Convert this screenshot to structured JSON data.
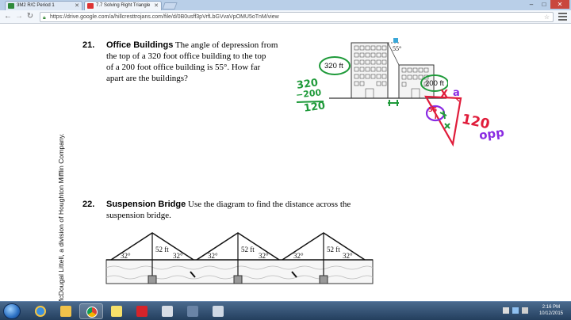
{
  "browser": {
    "tabs": [
      {
        "label": "3M2 R/C Period 1",
        "active": false
      },
      {
        "label": "7.7 Solving Right Triangle",
        "active": true
      }
    ],
    "url": "https://drive.google.com/a/hillcresttrojans.com/file/d/0B0usff3pVrfLbGVvaVpOMU5oTnM/view"
  },
  "page": {
    "copyright": "© by McDougal Littell, a division of Houghton Mifflin Company.",
    "problem21": {
      "number": "21.",
      "title": "Office Buildings",
      "lines": [
        "The angle of depression from",
        "the top of a 320 foot office building to the top",
        "of a 200 foot office building is 55°. How far",
        "apart are the buildings?"
      ],
      "figure_angle": "55°",
      "label_tall": "320 ft",
      "label_short": "200 ft"
    },
    "problem22": {
      "number": "22.",
      "title": "Suspension Bridge",
      "lines": [
        "Use the diagram to find the distance across the",
        "suspension bridge."
      ],
      "height_label": "52 ft",
      "angle_label": "32°"
    },
    "handwriting": {
      "sub_top": "320",
      "sub_mid": "200",
      "sub_result": "120",
      "triangle_angle": "55",
      "triangle_side": "120",
      "opp": "opp",
      "x": "X",
      "a": "a"
    }
  },
  "taskbar": {
    "time": "2:16 PM",
    "date": "10/12/2015"
  },
  "colors": {
    "hand_green": "#1f9a3a",
    "hand_red": "#e01c3a",
    "hand_purple": "#8a2be2"
  }
}
